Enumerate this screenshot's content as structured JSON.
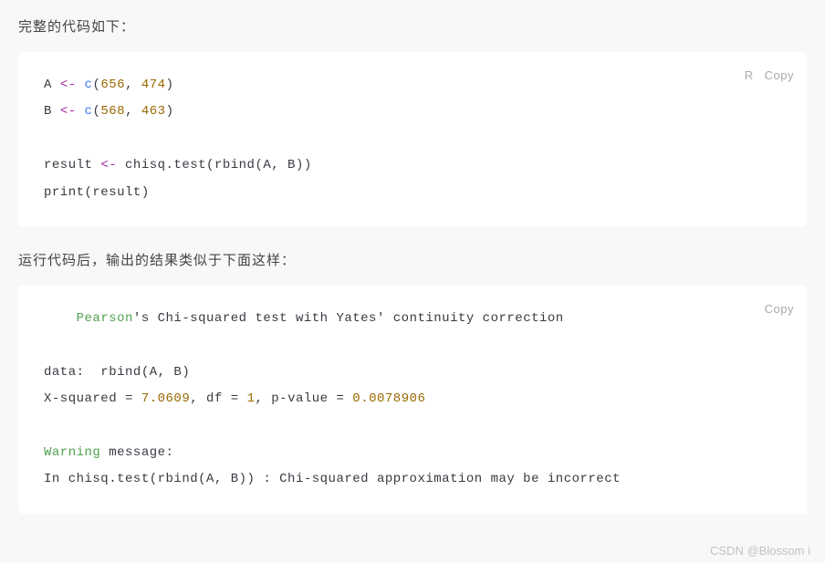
{
  "intro1": "完整的代码如下：",
  "block1": {
    "lang": "R",
    "copy": "Copy",
    "lines": {
      "l1_a": "A ",
      "l1_op": "<-",
      "l1_sp": " ",
      "l1_fn": "c",
      "l1_p1": "(",
      "l1_n1": "656",
      "l1_c1": ", ",
      "l1_n2": "474",
      "l1_p2": ")",
      "l2_a": "B ",
      "l2_op": "<-",
      "l2_sp": " ",
      "l2_fn": "c",
      "l2_p1": "(",
      "l2_n1": "568",
      "l2_c1": ", ",
      "l2_n2": "463",
      "l2_p2": ")",
      "l4_a": "result ",
      "l4_op": "<-",
      "l4_b": " chisq.test(rbind(A, B))",
      "l5": "print(result)"
    }
  },
  "intro2": "运行代码后，输出的结果类似于下面这样：",
  "block2": {
    "copy": "Copy",
    "lines": {
      "l1_indent": "    ",
      "l1_pearson": "Pearson",
      "l1_rest": "'s Chi-squared test with Yates' continuity correction",
      "l3": "data:  rbind(A, B)",
      "l4_a": "X-squared = ",
      "l4_n1": "7.0609",
      "l4_b": ", df = ",
      "l4_n2": "1",
      "l4_c": ", p-value = ",
      "l4_n3": "0.0078906",
      "l6_w": "Warning",
      "l6_r": " message:",
      "l7": "In chisq.test(rbind(A, B)) : Chi-squared approximation may be incorrect"
    }
  },
  "watermark": "CSDN @Blossom i"
}
